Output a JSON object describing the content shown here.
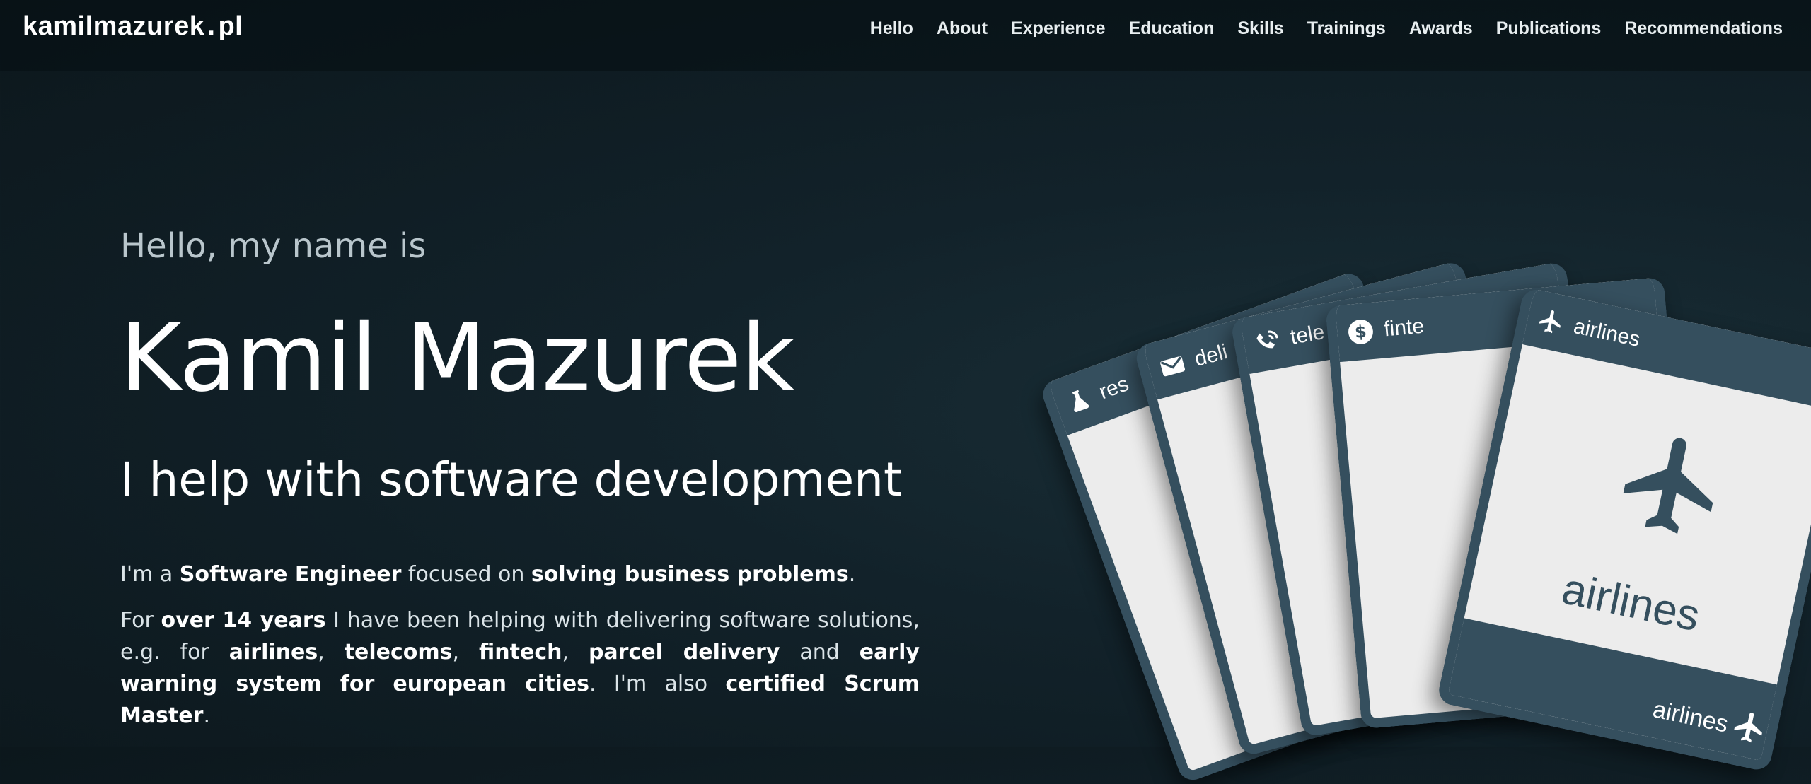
{
  "brand": {
    "name_left": "kamilmazurek",
    "dot": ".",
    "name_right": "pl"
  },
  "nav": {
    "items": [
      {
        "label": "Hello"
      },
      {
        "label": "About"
      },
      {
        "label": "Experience"
      },
      {
        "label": "Education"
      },
      {
        "label": "Skills"
      },
      {
        "label": "Trainings"
      },
      {
        "label": "Awards"
      },
      {
        "label": "Publications"
      },
      {
        "label": "Recommendations"
      }
    ]
  },
  "hero": {
    "greeting": "Hello, my name is",
    "name": "Kamil Mazurek",
    "tagline": "I help with software development",
    "p1": {
      "t1": "I'm a ",
      "b1": "Software Engineer",
      "t2": " focused on ",
      "b2": "solving business problems",
      "t3": "."
    },
    "p2": {
      "t1": "For ",
      "b1": "over 14 years",
      "t2": " I have been helping with delivering software solutions, e.g. for ",
      "b2": "airlines",
      "t3": ", ",
      "b3": "telecoms",
      "t4": ", ",
      "b4": "fintech",
      "t5": ", ",
      "b5": "parcel delivery",
      "t6": " and ",
      "b6": "early warning system for european cities",
      "t7": ". I'm also ",
      "b7": "certified Scrum Master",
      "t8": "."
    }
  },
  "cards": [
    {
      "label": "res",
      "icon": "flask-icon"
    },
    {
      "label": "deli",
      "icon": "envelope-icon"
    },
    {
      "label": "tele",
      "icon": "phone-wifi-icon"
    },
    {
      "label": "finte",
      "icon": "dollar-icon"
    },
    {
      "label": "airlines",
      "icon": "airplane-icon",
      "big_label": "airlines",
      "bottom_label": "airlines"
    }
  ],
  "colors": {
    "card_accent": "#354f5e",
    "card_face": "#ececec",
    "background": "#0f1d23"
  }
}
